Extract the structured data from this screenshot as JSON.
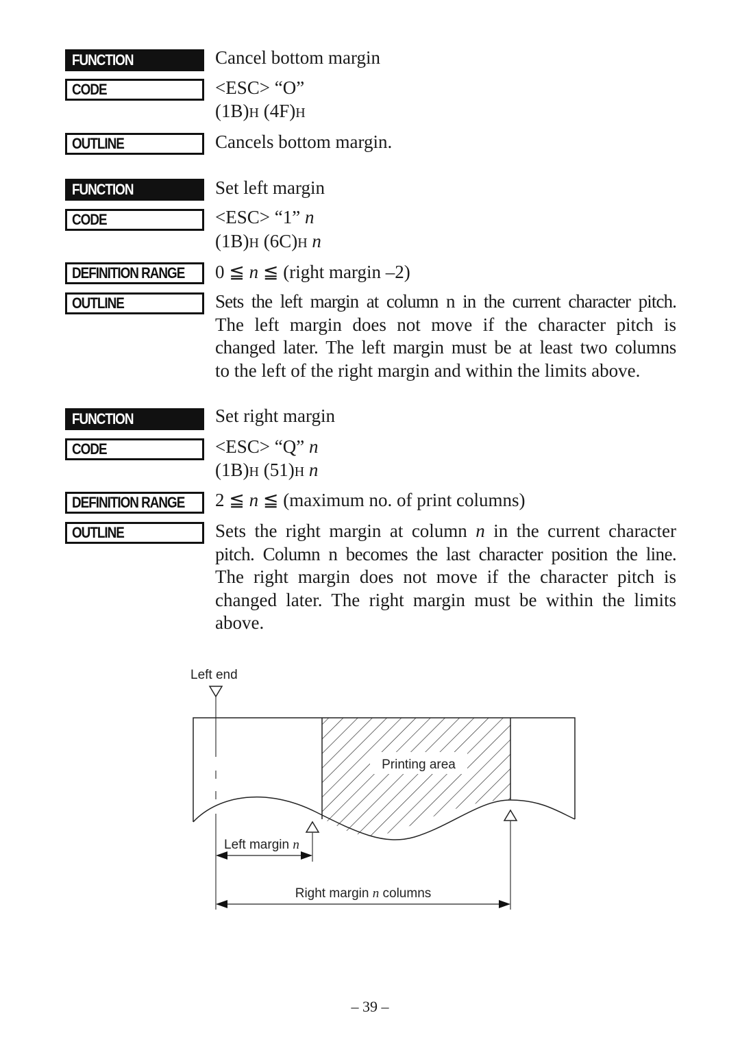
{
  "sections": [
    {
      "function_label": "FUNCTION",
      "function_value": "Cancel bottom margin",
      "code_label": "CODE",
      "code_line1": "<ESC> “O”",
      "code_line2": {
        "p1": "(1B)",
        "h1": "H",
        "p2": " (4F)",
        "h2": "H",
        "n": ""
      },
      "outline_label": "OUTLINE",
      "outline_lines": [
        "Cancels bottom margin."
      ]
    },
    {
      "function_label": "FUNCTION",
      "function_value": "Set left margin",
      "code_label": "CODE",
      "code_line1_prefix": "<ESC> “1” ",
      "code_line1_var": "n",
      "code_line2": {
        "p1": "(1B)",
        "h1": "H",
        "p2": " (6C)",
        "h2": "H",
        "n": " n"
      },
      "range_label": "DEFINITION RANGE",
      "range_pre": "0 ≦ ",
      "range_var": "n",
      "range_post": " ≦ (right margin –2)",
      "outline_label": "OUTLINE",
      "outline_lines": [
        "Sets the left margin at column n in the current character pitch.",
        "The left margin does not move if the character pitch is",
        "changed later. The left margin must be at least two columns",
        "to the left of the right margin and within the limits above."
      ]
    },
    {
      "function_label": "FUNCTION",
      "function_value": "Set right margin",
      "code_label": "CODE",
      "code_line1_prefix": "<ESC> “Q” ",
      "code_line1_var": "n",
      "code_line2": {
        "p1": "(1B)",
        "h1": "H",
        "p2": " (51)",
        "h2": "H",
        "n": " n"
      },
      "range_label": "DEFINITION RANGE",
      "range_pre": "2 ≦ ",
      "range_var": "n",
      "range_post": " ≦ (maximum no. of print columns)",
      "outline_label": "OUTLINE",
      "outline_line1_pre": "Sets the right margin at column ",
      "outline_line1_var": "n",
      "outline_line1_post": " in the current character",
      "outline_lines": [
        "pitch. Column n becomes the last character position the line.",
        "The right margin does not move if the character pitch is",
        "changed later. The right margin must be within the limits",
        "above."
      ]
    }
  ],
  "diagram": {
    "left_end_label": "Left end",
    "printing_area_label": "Printing area",
    "left_margin_label_pre": "Left margin ",
    "left_margin_label_var": "n",
    "right_margin_label_pre": "Right margin ",
    "right_margin_label_var": "n",
    "right_margin_label_post": " columns"
  },
  "page_number": "– 39 –"
}
